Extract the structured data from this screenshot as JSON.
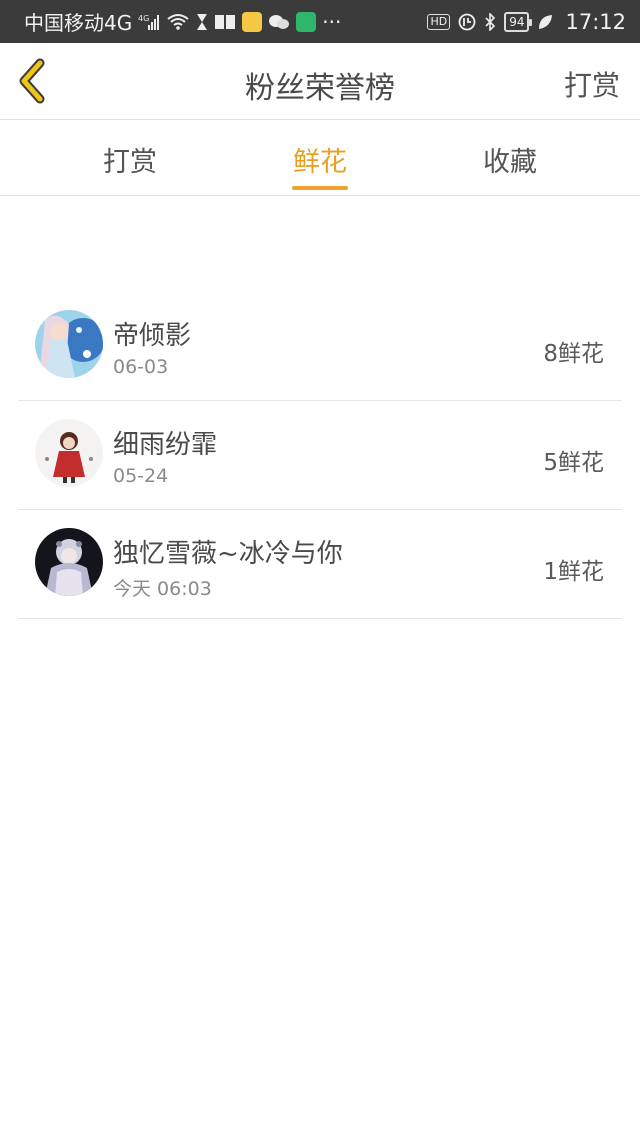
{
  "status_bar": {
    "carrier": "中国移动4G",
    "network_small": "4G",
    "battery": "94",
    "hd": "HD",
    "time": "17:12",
    "more": "···"
  },
  "header": {
    "title": "粉丝荣誉榜",
    "action_label": "打赏",
    "back_icon": "chevron-left-icon",
    "accent_color": "#e8a020"
  },
  "tabs": [
    {
      "label": "打赏",
      "active": false
    },
    {
      "label": "鲜花",
      "active": true
    },
    {
      "label": "收藏",
      "active": false
    }
  ],
  "fans": [
    {
      "name": "帝倾影",
      "date": "06-03",
      "count": "8鲜花"
    },
    {
      "name": "细雨纷霏",
      "date": "05-24",
      "count": "5鲜花"
    },
    {
      "name": "独忆雪薇~冰冷与你",
      "date": "今天 06:03",
      "count": "1鲜花"
    }
  ]
}
